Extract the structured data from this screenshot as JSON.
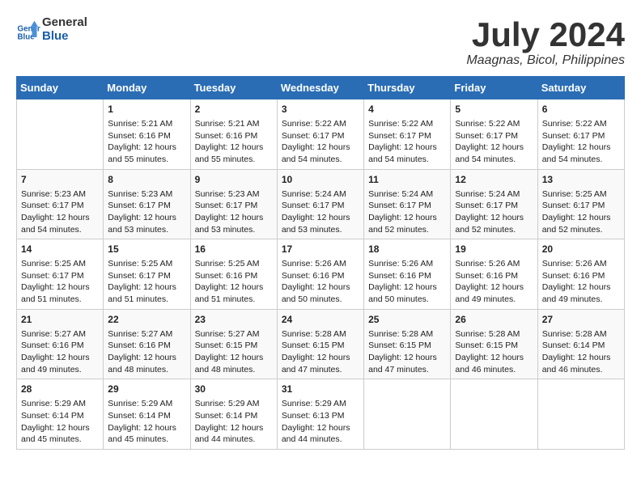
{
  "header": {
    "logo_line1": "General",
    "logo_line2": "Blue",
    "month_year": "July 2024",
    "location": "Maagnas, Bicol, Philippines"
  },
  "columns": [
    "Sunday",
    "Monday",
    "Tuesday",
    "Wednesday",
    "Thursday",
    "Friday",
    "Saturday"
  ],
  "weeks": [
    [
      {
        "day": "",
        "sunrise": "",
        "sunset": "",
        "daylight": ""
      },
      {
        "day": "1",
        "sunrise": "Sunrise: 5:21 AM",
        "sunset": "Sunset: 6:16 PM",
        "daylight": "Daylight: 12 hours and 55 minutes."
      },
      {
        "day": "2",
        "sunrise": "Sunrise: 5:21 AM",
        "sunset": "Sunset: 6:16 PM",
        "daylight": "Daylight: 12 hours and 55 minutes."
      },
      {
        "day": "3",
        "sunrise": "Sunrise: 5:22 AM",
        "sunset": "Sunset: 6:17 PM",
        "daylight": "Daylight: 12 hours and 54 minutes."
      },
      {
        "day": "4",
        "sunrise": "Sunrise: 5:22 AM",
        "sunset": "Sunset: 6:17 PM",
        "daylight": "Daylight: 12 hours and 54 minutes."
      },
      {
        "day": "5",
        "sunrise": "Sunrise: 5:22 AM",
        "sunset": "Sunset: 6:17 PM",
        "daylight": "Daylight: 12 hours and 54 minutes."
      },
      {
        "day": "6",
        "sunrise": "Sunrise: 5:22 AM",
        "sunset": "Sunset: 6:17 PM",
        "daylight": "Daylight: 12 hours and 54 minutes."
      }
    ],
    [
      {
        "day": "7",
        "sunrise": "Sunrise: 5:23 AM",
        "sunset": "Sunset: 6:17 PM",
        "daylight": "Daylight: 12 hours and 54 minutes."
      },
      {
        "day": "8",
        "sunrise": "Sunrise: 5:23 AM",
        "sunset": "Sunset: 6:17 PM",
        "daylight": "Daylight: 12 hours and 53 minutes."
      },
      {
        "day": "9",
        "sunrise": "Sunrise: 5:23 AM",
        "sunset": "Sunset: 6:17 PM",
        "daylight": "Daylight: 12 hours and 53 minutes."
      },
      {
        "day": "10",
        "sunrise": "Sunrise: 5:24 AM",
        "sunset": "Sunset: 6:17 PM",
        "daylight": "Daylight: 12 hours and 53 minutes."
      },
      {
        "day": "11",
        "sunrise": "Sunrise: 5:24 AM",
        "sunset": "Sunset: 6:17 PM",
        "daylight": "Daylight: 12 hours and 52 minutes."
      },
      {
        "day": "12",
        "sunrise": "Sunrise: 5:24 AM",
        "sunset": "Sunset: 6:17 PM",
        "daylight": "Daylight: 12 hours and 52 minutes."
      },
      {
        "day": "13",
        "sunrise": "Sunrise: 5:25 AM",
        "sunset": "Sunset: 6:17 PM",
        "daylight": "Daylight: 12 hours and 52 minutes."
      }
    ],
    [
      {
        "day": "14",
        "sunrise": "Sunrise: 5:25 AM",
        "sunset": "Sunset: 6:17 PM",
        "daylight": "Daylight: 12 hours and 51 minutes."
      },
      {
        "day": "15",
        "sunrise": "Sunrise: 5:25 AM",
        "sunset": "Sunset: 6:17 PM",
        "daylight": "Daylight: 12 hours and 51 minutes."
      },
      {
        "day": "16",
        "sunrise": "Sunrise: 5:25 AM",
        "sunset": "Sunset: 6:16 PM",
        "daylight": "Daylight: 12 hours and 51 minutes."
      },
      {
        "day": "17",
        "sunrise": "Sunrise: 5:26 AM",
        "sunset": "Sunset: 6:16 PM",
        "daylight": "Daylight: 12 hours and 50 minutes."
      },
      {
        "day": "18",
        "sunrise": "Sunrise: 5:26 AM",
        "sunset": "Sunset: 6:16 PM",
        "daylight": "Daylight: 12 hours and 50 minutes."
      },
      {
        "day": "19",
        "sunrise": "Sunrise: 5:26 AM",
        "sunset": "Sunset: 6:16 PM",
        "daylight": "Daylight: 12 hours and 49 minutes."
      },
      {
        "day": "20",
        "sunrise": "Sunrise: 5:26 AM",
        "sunset": "Sunset: 6:16 PM",
        "daylight": "Daylight: 12 hours and 49 minutes."
      }
    ],
    [
      {
        "day": "21",
        "sunrise": "Sunrise: 5:27 AM",
        "sunset": "Sunset: 6:16 PM",
        "daylight": "Daylight: 12 hours and 49 minutes."
      },
      {
        "day": "22",
        "sunrise": "Sunrise: 5:27 AM",
        "sunset": "Sunset: 6:16 PM",
        "daylight": "Daylight: 12 hours and 48 minutes."
      },
      {
        "day": "23",
        "sunrise": "Sunrise: 5:27 AM",
        "sunset": "Sunset: 6:15 PM",
        "daylight": "Daylight: 12 hours and 48 minutes."
      },
      {
        "day": "24",
        "sunrise": "Sunrise: 5:28 AM",
        "sunset": "Sunset: 6:15 PM",
        "daylight": "Daylight: 12 hours and 47 minutes."
      },
      {
        "day": "25",
        "sunrise": "Sunrise: 5:28 AM",
        "sunset": "Sunset: 6:15 PM",
        "daylight": "Daylight: 12 hours and 47 minutes."
      },
      {
        "day": "26",
        "sunrise": "Sunrise: 5:28 AM",
        "sunset": "Sunset: 6:15 PM",
        "daylight": "Daylight: 12 hours and 46 minutes."
      },
      {
        "day": "27",
        "sunrise": "Sunrise: 5:28 AM",
        "sunset": "Sunset: 6:14 PM",
        "daylight": "Daylight: 12 hours and 46 minutes."
      }
    ],
    [
      {
        "day": "28",
        "sunrise": "Sunrise: 5:29 AM",
        "sunset": "Sunset: 6:14 PM",
        "daylight": "Daylight: 12 hours and 45 minutes."
      },
      {
        "day": "29",
        "sunrise": "Sunrise: 5:29 AM",
        "sunset": "Sunset: 6:14 PM",
        "daylight": "Daylight: 12 hours and 45 minutes."
      },
      {
        "day": "30",
        "sunrise": "Sunrise: 5:29 AM",
        "sunset": "Sunset: 6:14 PM",
        "daylight": "Daylight: 12 hours and 44 minutes."
      },
      {
        "day": "31",
        "sunrise": "Sunrise: 5:29 AM",
        "sunset": "Sunset: 6:13 PM",
        "daylight": "Daylight: 12 hours and 44 minutes."
      },
      {
        "day": "",
        "sunrise": "",
        "sunset": "",
        "daylight": ""
      },
      {
        "day": "",
        "sunrise": "",
        "sunset": "",
        "daylight": ""
      },
      {
        "day": "",
        "sunrise": "",
        "sunset": "",
        "daylight": ""
      }
    ]
  ]
}
